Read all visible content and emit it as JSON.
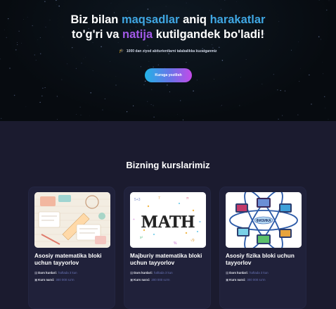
{
  "hero": {
    "title_parts": {
      "t1": "Biz bilan ",
      "h1": "maqsadlar",
      "t2": " aniq ",
      "h2": "harakatlar",
      "t3": "to'g'ri va ",
      "h3": "natija",
      "t4": " kutilgandek bo'ladi!"
    },
    "subtitle": "1000 dan ziyod abiturientlarni talabalikka kuzatganmiz",
    "subtitle_icon": "graduation-cap-icon",
    "cta_label": "Kursga yozilish"
  },
  "courses": {
    "title": "Bizning kurslarimiz",
    "schedule_label": "Dars kunlari:",
    "price_label": "Kurs narxi:",
    "items": [
      {
        "title": "Asosiy matematika bloki uchun tayyorlov",
        "schedule": "haftada 3 kun",
        "price": "300 000 so'm",
        "image": "math-sketch-illustration"
      },
      {
        "title": "Majburiy matematika bloki uchun tayyorlov",
        "schedule": "haftada 3 kun",
        "price": "200 000 so'm",
        "image": "math-word-illustration",
        "image_text": "MATH"
      },
      {
        "title": "Asosiy fizika bloki uchun tayyorlov",
        "schedule": "haftada 3 kun",
        "price": "300 000 so'm",
        "image": "physics-atom-illustration",
        "image_text": "ФИЗИКА"
      }
    ]
  },
  "colors": {
    "accent_blue": "#3fa6e2",
    "accent_purple": "#a259e8",
    "background": "#1b1b2f",
    "card": "#20213a"
  }
}
